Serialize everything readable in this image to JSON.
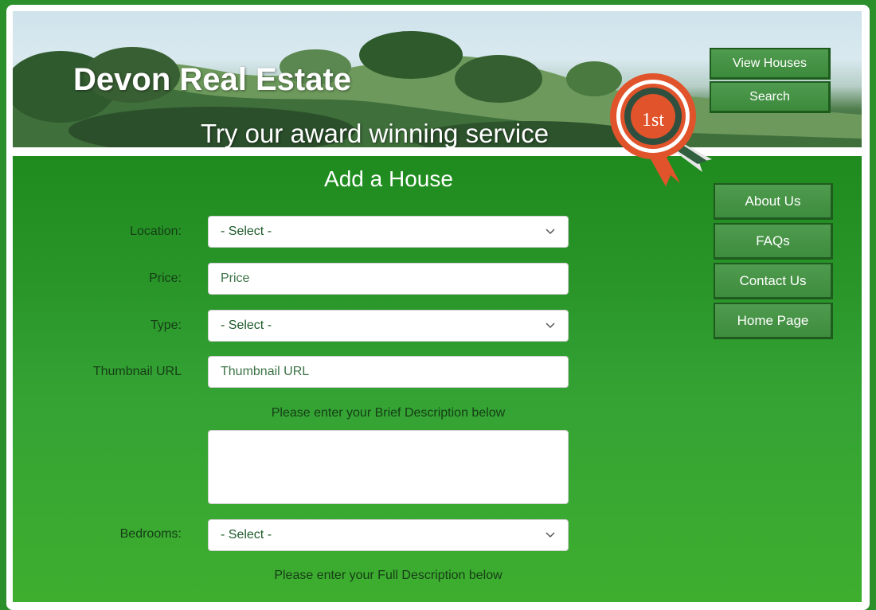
{
  "header": {
    "title": "Devon Real Estate",
    "tagline": "Try our award winning service",
    "badge_text": "1st",
    "nav": [
      {
        "label": "View Houses"
      },
      {
        "label": "Search"
      }
    ]
  },
  "sidebar": {
    "items": [
      {
        "label": "About Us"
      },
      {
        "label": "FAQs"
      },
      {
        "label": "Contact Us"
      },
      {
        "label": "Home Page"
      }
    ]
  },
  "form": {
    "heading": "Add a House",
    "location": {
      "label": "Location:",
      "value": "- Select -"
    },
    "price": {
      "label": "Price:",
      "placeholder": "Price"
    },
    "type": {
      "label": "Type:",
      "value": "- Select -"
    },
    "thumbnail": {
      "label": "Thumbnail URL",
      "placeholder": "Thumbnail URL"
    },
    "brief_hint": "Please enter your Brief Description below",
    "bedrooms": {
      "label": "Bedrooms:",
      "value": "- Select -"
    },
    "full_hint": "Please enter your Full Description below"
  },
  "colors": {
    "content_green": "#2a962a",
    "button_green": "#4a974a",
    "label_text": "#163d16",
    "rosette_red": "#e0532b"
  }
}
